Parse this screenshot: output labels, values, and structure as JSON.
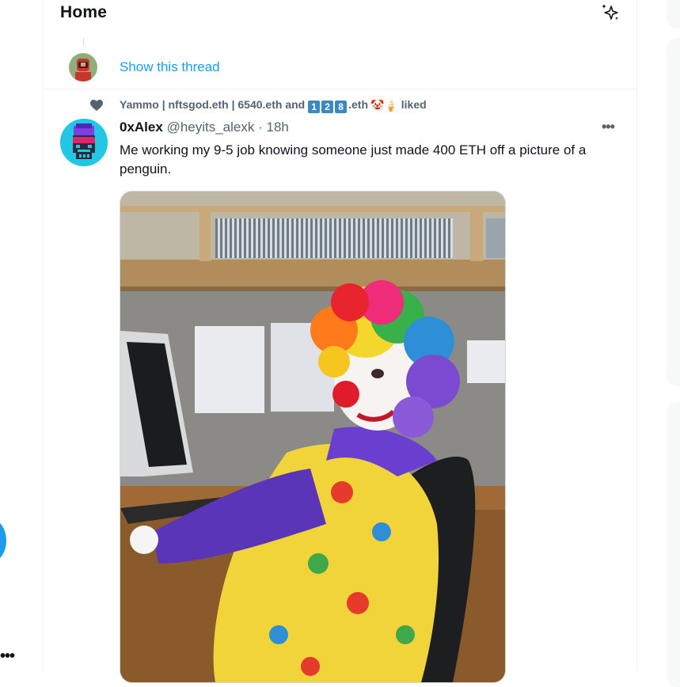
{
  "header": {
    "title": "Home",
    "icon": "sparkle-icon"
  },
  "thread": {
    "show_label": "Show this thread"
  },
  "social_context": {
    "prefix": "Yammo | nftsgod.eth | 6540.eth and ",
    "key_digits": [
      "1",
      "2",
      "8"
    ],
    "suffix": ".eth",
    "emojis": "🤡🍦",
    "liked": "liked"
  },
  "tweet": {
    "name": "0xAlex",
    "handle": "@heyits_alexk",
    "separator": "·",
    "time": "18h",
    "text": "Me working my 9-5 job knowing someone just made 400 ETH off a picture of a penguin.",
    "more": "•••"
  },
  "left": {
    "more": "•••"
  },
  "colors": {
    "accent": "#1d9bf0",
    "secondary_text": "#536471",
    "divider": "#eff3f4"
  }
}
